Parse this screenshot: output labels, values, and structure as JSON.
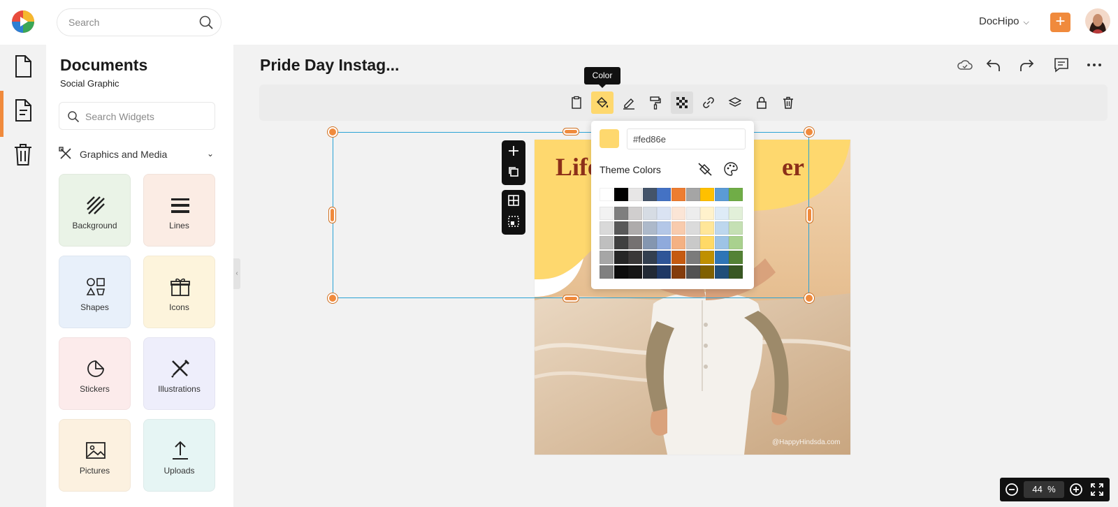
{
  "header": {
    "search_placeholder": "Search",
    "brand_menu_label": "DocHipo",
    "new_label": "+"
  },
  "panel": {
    "title": "Documents",
    "subtitle": "Social Graphic",
    "search_placeholder": "Search Widgets",
    "section_label": "Graphics and Media",
    "cards": [
      {
        "label": "Background",
        "icon": "background-pattern-icon",
        "bg": "#eaf3e7"
      },
      {
        "label": "Lines",
        "icon": "lines-icon",
        "bg": "#fbece4"
      },
      {
        "label": "Shapes",
        "icon": "shapes-icon",
        "bg": "#e8f0fa"
      },
      {
        "label": "Icons",
        "icon": "gift-icon",
        "bg": "#fdf4dc"
      },
      {
        "label": "Stickers",
        "icon": "sticker-icon",
        "bg": "#fcebeb"
      },
      {
        "label": "Illustrations",
        "icon": "illustration-tools-icon",
        "bg": "#eeeefb"
      },
      {
        "label": "Pictures",
        "icon": "picture-icon",
        "bg": "#fcf1e0"
      },
      {
        "label": "Uploads",
        "icon": "upload-icon",
        "bg": "#e6f5f4"
      }
    ]
  },
  "editor": {
    "doc_title": "Pride Day Instag...",
    "tooltip": "Color",
    "canvas_heading_left": "Life",
    "canvas_heading_right": "er",
    "watermark": "@HappyHindsda.com"
  },
  "color_picker": {
    "hex_value": "#fed86e",
    "current_color": "#fed86e",
    "theme_label": "Theme Colors",
    "top_row": [
      "#ffffff",
      "#000000",
      "#e7e6e6",
      "#44546a",
      "#4472c4",
      "#ed7d31",
      "#a5a5a5",
      "#ffc000",
      "#5b9bd5",
      "#70ad47"
    ],
    "shade_columns": [
      [
        "#f2f2f2",
        "#d9d9d9",
        "#bfbfbf",
        "#a6a6a6",
        "#808080"
      ],
      [
        "#7f7f7f",
        "#595959",
        "#404040",
        "#262626",
        "#0d0d0d"
      ],
      [
        "#d0cece",
        "#aeabab",
        "#757171",
        "#3a3838",
        "#161616"
      ],
      [
        "#d6dce4",
        "#adb9ca",
        "#8496b0",
        "#333f4f",
        "#222a35"
      ],
      [
        "#dae3f3",
        "#b4c7e7",
        "#8faadc",
        "#2f5597",
        "#1f3864"
      ],
      [
        "#fbe5d6",
        "#f8cbad",
        "#f4b183",
        "#c55a11",
        "#843c0c"
      ],
      [
        "#ededed",
        "#dbdbdb",
        "#c9c9c9",
        "#7b7b7b",
        "#525252"
      ],
      [
        "#fff2cc",
        "#ffe699",
        "#ffd966",
        "#bf9000",
        "#7f6000"
      ],
      [
        "#deebf7",
        "#bdd7ee",
        "#9dc3e6",
        "#2e75b6",
        "#1f4e79"
      ],
      [
        "#e2f0d9",
        "#c5e0b4",
        "#a9d18e",
        "#548235",
        "#385723"
      ]
    ]
  },
  "zoom": {
    "value": "44",
    "unit": "%"
  },
  "colors": {
    "accent": "#f08a3c",
    "selection": "#2aa2d5",
    "canvas_yellow": "#fed86e"
  }
}
